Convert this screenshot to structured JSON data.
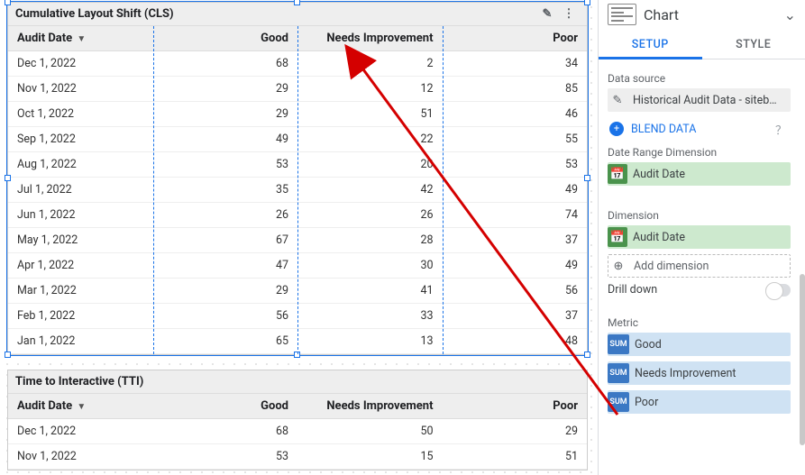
{
  "chart_data": [
    {
      "type": "table",
      "title": "Cumulative Layout Shift (CLS)",
      "columns": [
        "Audit Date",
        "Good",
        "Needs Improvement",
        "Poor"
      ],
      "sort_column": "Audit Date",
      "rows": [
        {
          "date": "Dec 1, 2022",
          "good": 68,
          "needs": 2,
          "poor": 34
        },
        {
          "date": "Nov 1, 2022",
          "good": 29,
          "needs": 12,
          "poor": 85
        },
        {
          "date": "Oct 1, 2022",
          "good": 29,
          "needs": 51,
          "poor": 46
        },
        {
          "date": "Sep 1, 2022",
          "good": 49,
          "needs": 22,
          "poor": 55
        },
        {
          "date": "Aug 1, 2022",
          "good": 53,
          "needs": 20,
          "poor": 53
        },
        {
          "date": "Jul 1, 2022",
          "good": 35,
          "needs": 42,
          "poor": 49
        },
        {
          "date": "Jun 1, 2022",
          "good": 26,
          "needs": 26,
          "poor": 74
        },
        {
          "date": "May 1, 2022",
          "good": 67,
          "needs": 28,
          "poor": 37
        },
        {
          "date": "Apr 1, 2022",
          "good": 47,
          "needs": 30,
          "poor": 49
        },
        {
          "date": "Mar 1, 2022",
          "good": 29,
          "needs": 41,
          "poor": 56
        },
        {
          "date": "Feb 1, 2022",
          "good": 56,
          "needs": 33,
          "poor": 37
        },
        {
          "date": "Jan 1, 2022",
          "good": 65,
          "needs": 13,
          "poor": 48
        }
      ]
    },
    {
      "type": "table",
      "title": "Time to Interactive (TTI)",
      "columns": [
        "Audit Date",
        "Good",
        "Needs Improvement",
        "Poor"
      ],
      "sort_column": "Audit Date",
      "rows": [
        {
          "date": "Dec 1, 2022",
          "good": 68,
          "needs": 50,
          "poor": 29
        },
        {
          "date": "Nov 1, 2022",
          "good": 53,
          "needs": 15,
          "poor": 51
        }
      ]
    }
  ],
  "panel": {
    "title": "Chart",
    "tabs": {
      "setup": "SETUP",
      "style": "STYLE"
    },
    "data_source_label": "Data source",
    "data_source_name": "Historical Audit Data - siteb…",
    "blend": "BLEND DATA",
    "date_range_label": "Date Range Dimension",
    "date_range_field": "Audit Date",
    "dimension_label": "Dimension",
    "dimension_field": "Audit Date",
    "add_dimension": "Add dimension",
    "drill_down": "Drill down",
    "metric_label": "Metric",
    "metric_prefix": "SUM",
    "metrics": [
      "Good",
      "Needs Improvement",
      "Poor"
    ]
  },
  "sort_indicator": "▼"
}
